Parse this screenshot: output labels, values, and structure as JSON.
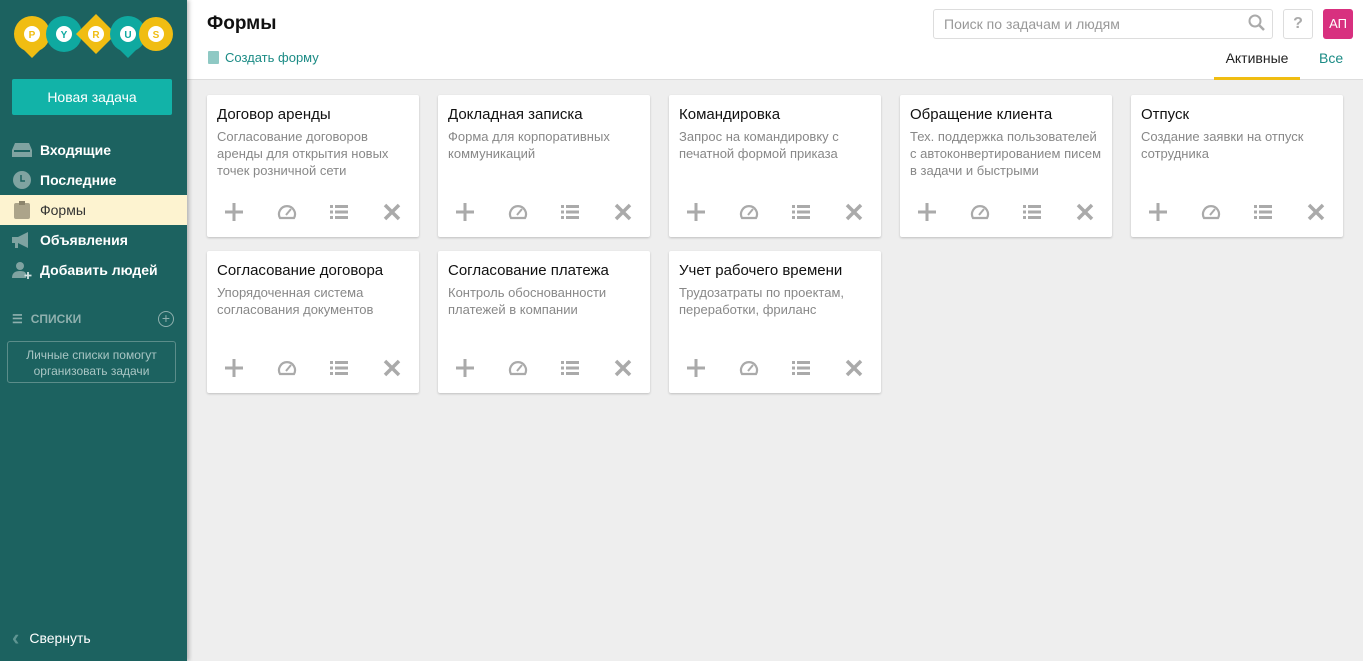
{
  "sidebar": {
    "logo_letters": [
      "P",
      "Y",
      "R",
      "U",
      "S"
    ],
    "new_task": "Новая задача",
    "items": [
      {
        "label": "Входящие",
        "icon": "inbox-icon"
      },
      {
        "label": "Последние",
        "icon": "clock-icon"
      },
      {
        "label": "Формы",
        "icon": "clipboard-icon",
        "active": true
      },
      {
        "label": "Объявления",
        "icon": "megaphone-icon"
      },
      {
        "label": "Добавить людей",
        "icon": "add-user-icon"
      }
    ],
    "lists_label": "СПИСКИ",
    "lists_tip": "Личные списки помогут организовать задачи",
    "collapse": "Свернуть"
  },
  "header": {
    "title": "Формы",
    "create_form": "Создать форму",
    "search_placeholder": "Поиск по задачам и людям",
    "help": "?",
    "avatar": "АП",
    "tabs": [
      "Активные",
      "Все"
    ]
  },
  "forms": [
    {
      "title": "Договор аренды",
      "desc": "Согласование договоров аренды для открытия новых точек розничной сети"
    },
    {
      "title": "Докладная записка",
      "desc": "Форма для корпоративных коммуникаций"
    },
    {
      "title": "Командировка",
      "desc": "Запрос на командировку с печатной формой приказа"
    },
    {
      "title": "Обращение клиента",
      "desc": "Тех. поддержка пользователей с автоконвертированием писем в задачи и быстрыми"
    },
    {
      "title": "Отпуск",
      "desc": "Создание заявки на отпуск сотрудника"
    },
    {
      "title": "Согласование договора",
      "desc": "Упорядоченная система согласования документов"
    },
    {
      "title": "Согласование платежа",
      "desc": "Контроль обоснованности платежей в компании"
    },
    {
      "title": "Учет рабочего времени",
      "desc": "Трудозатраты по проектам, переработки, фриланс"
    }
  ],
  "colors": {
    "sidebar": "#1c6260",
    "accent": "#12b3a8",
    "yellow": "#f0bd12",
    "avatar": "#d8307f"
  }
}
